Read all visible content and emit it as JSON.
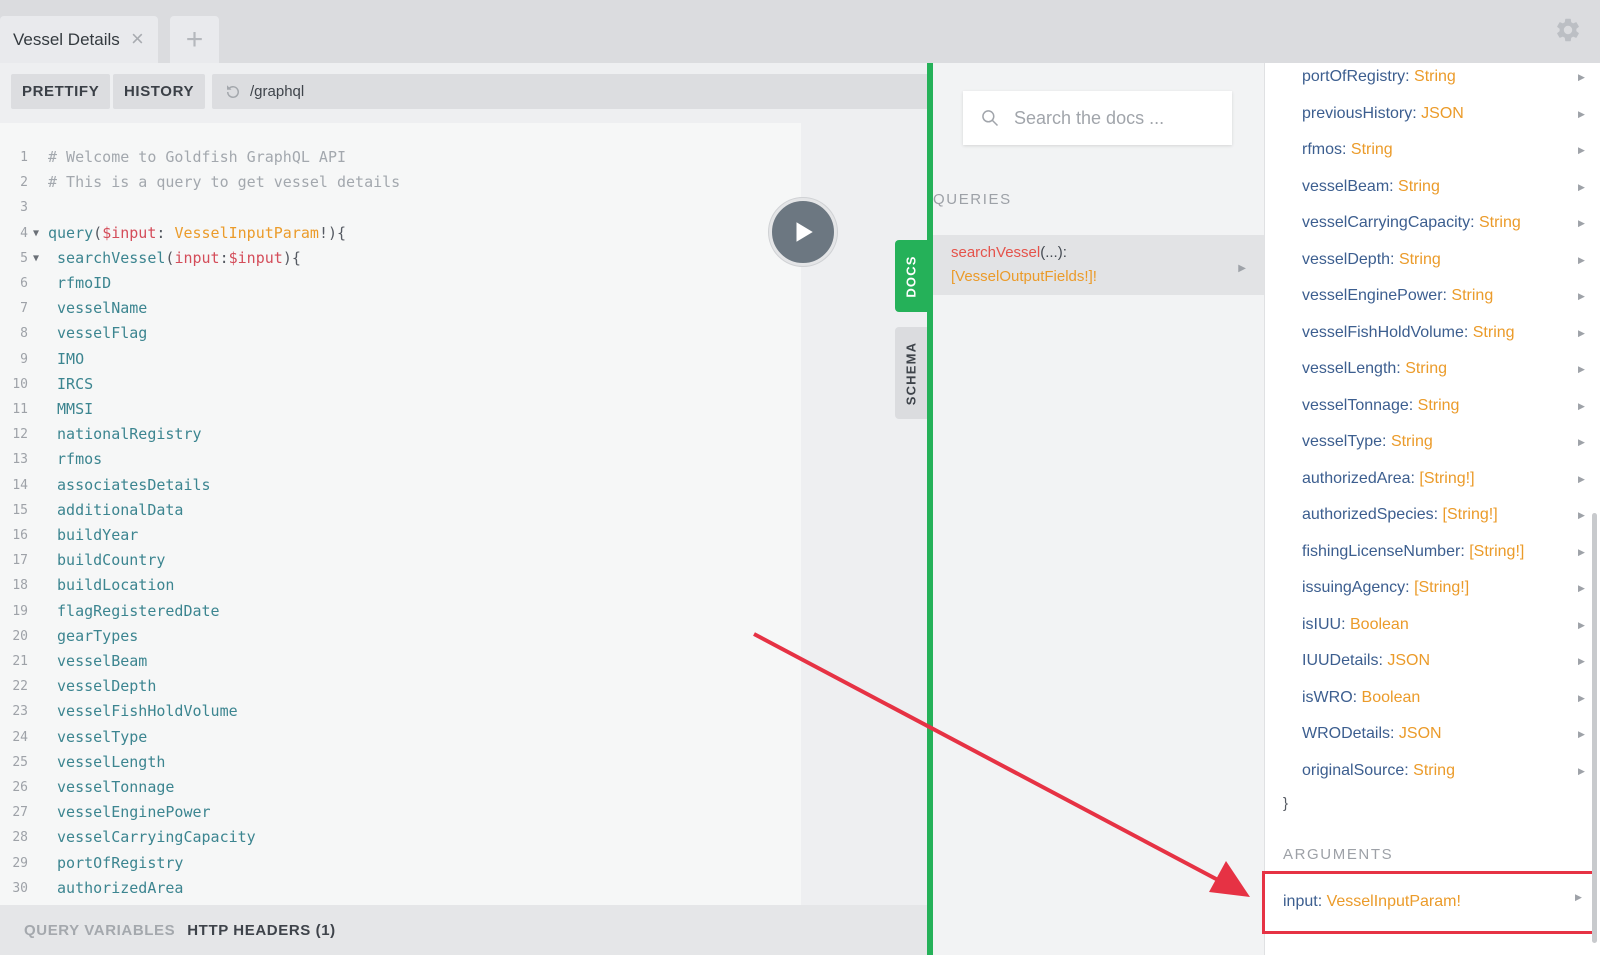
{
  "tabs": {
    "active_label": "Vessel Details",
    "close_glyph": "×",
    "add_glyph": "+"
  },
  "toolbar": {
    "prettify_label": "PRETTIFY",
    "history_label": "HISTORY",
    "endpoint": "/graphql"
  },
  "editor": {
    "lines": [
      {
        "n": "1",
        "parts": [
          {
            "t": "# Welcome to Goldfish GraphQL API",
            "c": "c-comment"
          }
        ]
      },
      {
        "n": "2",
        "parts": [
          {
            "t": "# This is a query to get vessel details",
            "c": "c-comment"
          }
        ]
      },
      {
        "n": "3",
        "parts": []
      },
      {
        "n": "4",
        "fold": true,
        "parts": [
          {
            "t": "query",
            "c": "c-keyword"
          },
          {
            "t": "(",
            "c": "c-punct"
          },
          {
            "t": "$input",
            "c": "c-var"
          },
          {
            "t": ": ",
            "c": "c-punct"
          },
          {
            "t": "VesselInputParam",
            "c": "c-type"
          },
          {
            "t": "!){",
            "c": "c-punct"
          }
        ]
      },
      {
        "n": "5",
        "fold": true,
        "parts": [
          {
            "t": " searchVessel",
            "c": "c-field"
          },
          {
            "t": "(",
            "c": "c-punct"
          },
          {
            "t": "input",
            "c": "c-var"
          },
          {
            "t": ":",
            "c": "c-punct"
          },
          {
            "t": "$input",
            "c": "c-var"
          },
          {
            "t": "){",
            "c": "c-punct"
          }
        ]
      },
      {
        "n": "6",
        "parts": [
          {
            "t": " rfmoID",
            "c": "c-field"
          }
        ]
      },
      {
        "n": "7",
        "parts": [
          {
            "t": " vesselName",
            "c": "c-field"
          }
        ]
      },
      {
        "n": "8",
        "parts": [
          {
            "t": " vesselFlag",
            "c": "c-field"
          }
        ]
      },
      {
        "n": "9",
        "parts": [
          {
            "t": " IMO",
            "c": "c-field"
          }
        ]
      },
      {
        "n": "10",
        "parts": [
          {
            "t": " IRCS",
            "c": "c-field"
          }
        ]
      },
      {
        "n": "11",
        "parts": [
          {
            "t": " MMSI",
            "c": "c-field"
          }
        ]
      },
      {
        "n": "12",
        "parts": [
          {
            "t": " nationalRegistry",
            "c": "c-field"
          }
        ]
      },
      {
        "n": "13",
        "parts": [
          {
            "t": " rfmos",
            "c": "c-field"
          }
        ]
      },
      {
        "n": "14",
        "parts": [
          {
            "t": " associatesDetails",
            "c": "c-field"
          }
        ]
      },
      {
        "n": "15",
        "parts": [
          {
            "t": " additionalData",
            "c": "c-field"
          }
        ]
      },
      {
        "n": "16",
        "parts": [
          {
            "t": " buildYear",
            "c": "c-field"
          }
        ]
      },
      {
        "n": "17",
        "parts": [
          {
            "t": " buildCountry",
            "c": "c-field"
          }
        ]
      },
      {
        "n": "18",
        "parts": [
          {
            "t": " buildLocation",
            "c": "c-field"
          }
        ]
      },
      {
        "n": "19",
        "parts": [
          {
            "t": " flagRegisteredDate",
            "c": "c-field"
          }
        ]
      },
      {
        "n": "20",
        "parts": [
          {
            "t": " gearTypes",
            "c": "c-field"
          }
        ]
      },
      {
        "n": "21",
        "parts": [
          {
            "t": " vesselBeam",
            "c": "c-field"
          }
        ]
      },
      {
        "n": "22",
        "parts": [
          {
            "t": " vesselDepth",
            "c": "c-field"
          }
        ]
      },
      {
        "n": "23",
        "parts": [
          {
            "t": " vesselFishHoldVolume",
            "c": "c-field"
          }
        ]
      },
      {
        "n": "24",
        "parts": [
          {
            "t": " vesselType",
            "c": "c-field"
          }
        ]
      },
      {
        "n": "25",
        "parts": [
          {
            "t": " vesselLength",
            "c": "c-field"
          }
        ]
      },
      {
        "n": "26",
        "parts": [
          {
            "t": " vesselTonnage",
            "c": "c-field"
          }
        ]
      },
      {
        "n": "27",
        "parts": [
          {
            "t": " vesselEnginePower",
            "c": "c-field"
          }
        ]
      },
      {
        "n": "28",
        "parts": [
          {
            "t": " vesselCarryingCapacity",
            "c": "c-field"
          }
        ]
      },
      {
        "n": "29",
        "parts": [
          {
            "t": " portOfRegistry",
            "c": "c-field"
          }
        ]
      },
      {
        "n": "30",
        "parts": [
          {
            "t": " authorizedArea",
            "c": "c-field"
          }
        ]
      }
    ]
  },
  "bottom_bar": {
    "query_variables_label": "QUERY VARIABLES",
    "http_headers_label": "HTTP HEADERS (1)"
  },
  "side_tabs": {
    "docs_label": "DOCS",
    "schema_label": "SCHEMA"
  },
  "docs": {
    "search_placeholder": "Search the docs ...",
    "queries_label": "QUERIES",
    "query": {
      "name": "searchVessel",
      "args": "(...):",
      "type": "[VesselOutputFields!]!"
    }
  },
  "fields": [
    {
      "name": "portOfRegistry",
      "type": "String"
    },
    {
      "name": "previousHistory",
      "type": "JSON"
    },
    {
      "name": "rfmos",
      "type": "String"
    },
    {
      "name": "vesselBeam",
      "type": "String"
    },
    {
      "name": "vesselCarryingCapacity",
      "type": "String"
    },
    {
      "name": "vesselDepth",
      "type": "String"
    },
    {
      "name": "vesselEnginePower",
      "type": "String"
    },
    {
      "name": "vesselFishHoldVolume",
      "type": "String"
    },
    {
      "name": "vesselLength",
      "type": "String"
    },
    {
      "name": "vesselTonnage",
      "type": "String"
    },
    {
      "name": "vesselType",
      "type": "String"
    },
    {
      "name": "authorizedArea",
      "type": "[String!]"
    },
    {
      "name": "authorizedSpecies",
      "type": "[String!]"
    },
    {
      "name": "fishingLicenseNumber",
      "type": "[String!]"
    },
    {
      "name": "issuingAgency",
      "type": "[String!]"
    },
    {
      "name": "isIUU",
      "type": "Boolean"
    },
    {
      "name": "IUUDetails",
      "type": "JSON"
    },
    {
      "name": "isWRO",
      "type": "Boolean"
    },
    {
      "name": "WRODetails",
      "type": "JSON"
    },
    {
      "name": "originalSource",
      "type": "String"
    }
  ],
  "closing_brace": "}",
  "arguments": {
    "label": "ARGUMENTS",
    "items": [
      {
        "name": "input",
        "type": "VesselInputParam!"
      }
    ]
  },
  "colors": {
    "accent_green": "#25b159",
    "highlight_red": "#e63244",
    "type_orange": "#eb9b2a",
    "field_blue": "#3c5e8f"
  },
  "icons": {
    "play": "play-icon",
    "gear": "gear-icon",
    "search": "search-icon",
    "history": "reload-icon",
    "arrow": "chevron-right-icon"
  }
}
